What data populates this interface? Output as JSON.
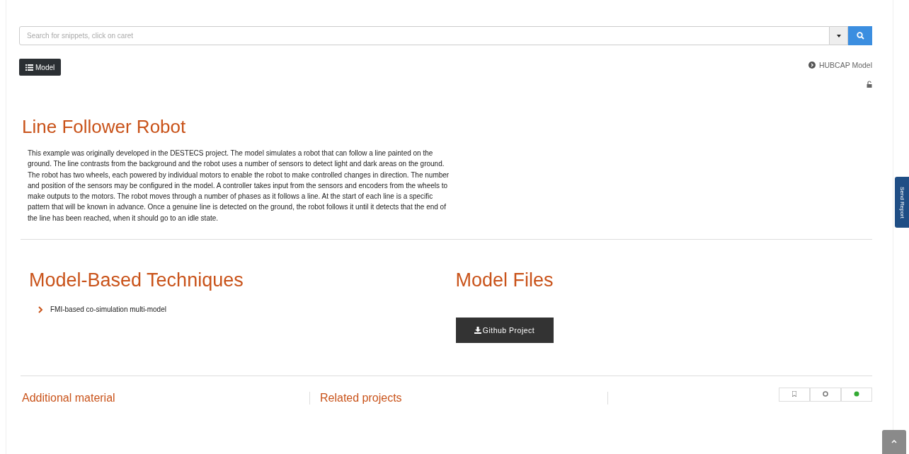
{
  "search": {
    "placeholder": "Search for snippets, click on caret"
  },
  "model_button": {
    "label": "Model"
  },
  "hubcap_link": {
    "label": "HUBCAP Model"
  },
  "title": "Line Follower Robot",
  "description": "This example was originally developed in the DESTECS project. The model simulates a robot that can follow a line painted on the ground. The line contrasts from the background and the robot uses a number of sensors to detect light and dark areas on the ground. The robot has two wheels, each powered by individual motors to enable the robot to make controlled changes in direction. The number and position of the sensors may be configured in the model. A controller takes input from the sensors and encoders from the wheels to make outputs to the motors. The robot moves through a number of phases as it follows a line. At the start of each line is a specific pattern that will be known in advance. Once a genuine line is detected on the ground, the robot follows it until it detects that the end of the line has been reached, when it should go to an idle state.",
  "techniques": {
    "heading": "Model-Based Techniques",
    "items": [
      "FMI-based co-simulation multi-model"
    ]
  },
  "model_files": {
    "heading": "Model Files",
    "button": "Github Project"
  },
  "bottom_headings": [
    "Additional material",
    "Related projects"
  ],
  "send_report": "Send Report"
}
